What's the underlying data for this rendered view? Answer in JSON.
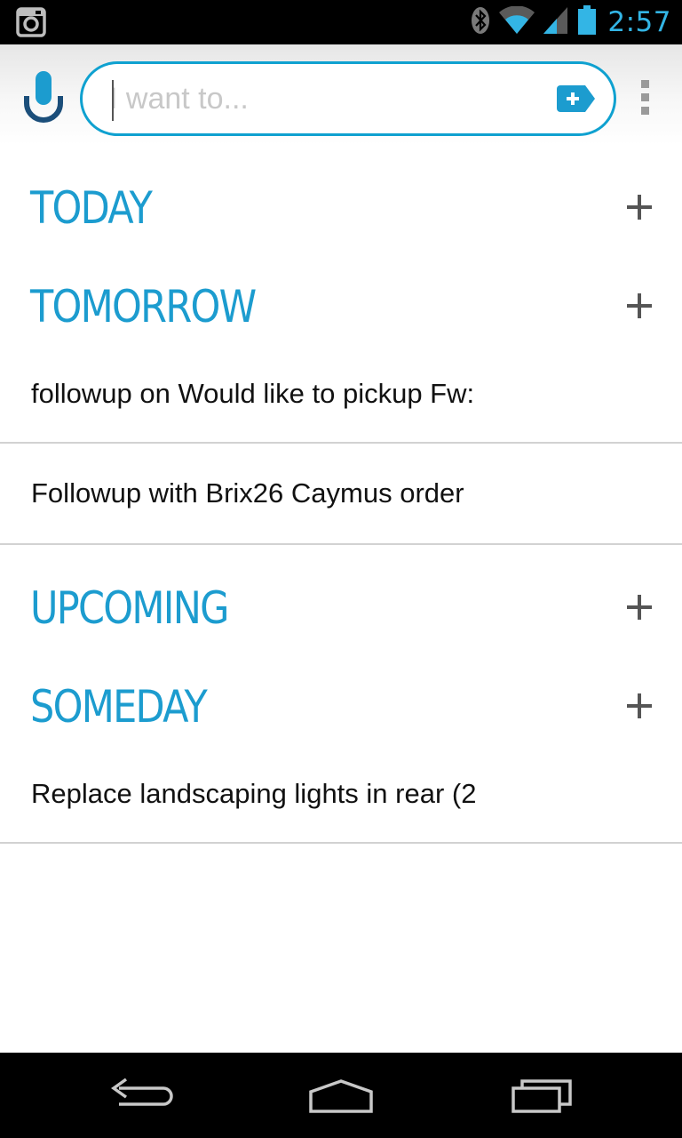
{
  "status_bar": {
    "time": "2:57",
    "icons": [
      "instagram-icon",
      "bluetooth-icon",
      "wifi-icon",
      "signal-icon",
      "battery-icon"
    ]
  },
  "search": {
    "placeholder": "I want to..."
  },
  "sections": [
    {
      "title": "TODAY",
      "tasks": []
    },
    {
      "title": "TOMORROW",
      "tasks": [
        {
          "text": "followup on Would like to pickup Fw:"
        },
        {
          "text": "Followup with Brix26 Caymus order"
        }
      ]
    },
    {
      "title": "UPCOMING",
      "tasks": []
    },
    {
      "title": "SOMEDAY",
      "tasks": [
        {
          "text": "Replace landscaping lights in rear (2"
        }
      ]
    }
  ],
  "colors": {
    "accent": "#1c9ccf",
    "search_border": "#0fa1d0",
    "clock": "#33b5e5",
    "divider": "#d2d2d2"
  },
  "nav_bar": {
    "icons": [
      "back-icon",
      "home-icon",
      "recent-apps-icon"
    ]
  }
}
